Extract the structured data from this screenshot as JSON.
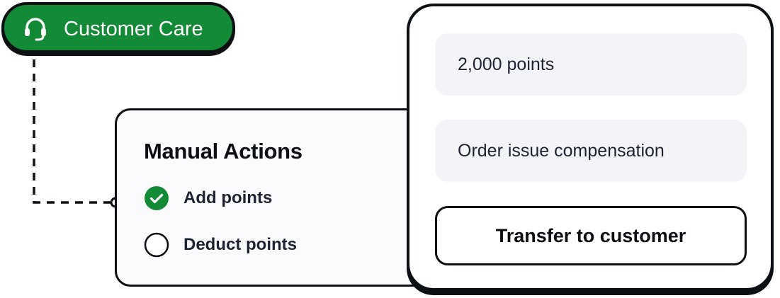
{
  "customer_care": {
    "label": "Customer Care",
    "icon": "headset-icon",
    "color": "#138a36"
  },
  "manual_actions": {
    "title": "Manual Actions",
    "options": [
      {
        "label": "Add points",
        "selected": true,
        "icon": "check-circle-icon"
      },
      {
        "label": "Deduct points",
        "selected": false,
        "icon": "empty-circle-icon"
      }
    ]
  },
  "transfer": {
    "amount_value": "2,000 points",
    "reason_value": "Order issue compensation",
    "submit_label": "Transfer to customer"
  }
}
